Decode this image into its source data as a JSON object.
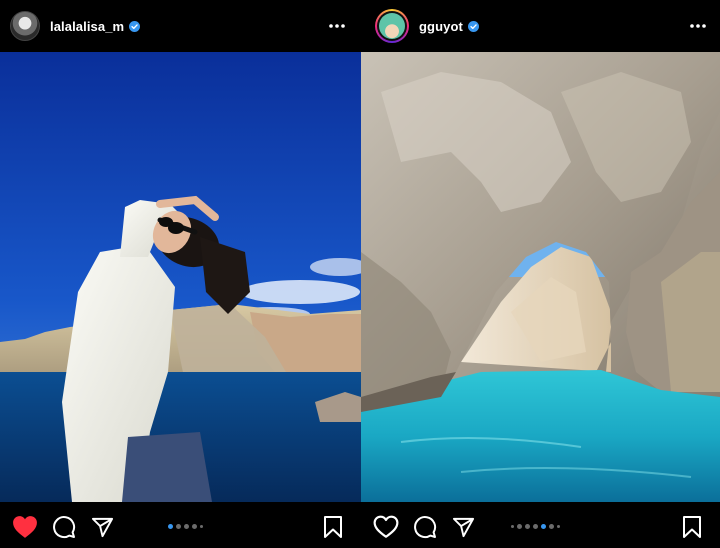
{
  "posts": [
    {
      "username": "lalalalisa_m",
      "verified": true,
      "liked": true,
      "active_slide": 0,
      "photo": "woman in white shirt and sunglasses on a boat, cliffs and blue sea behind"
    },
    {
      "username": "gguyot",
      "verified": true,
      "liked": false,
      "active_slide": 4,
      "photo": "natural rock arch over turquoise sea water"
    }
  ],
  "icons": {
    "more": "more-horizontal-icon",
    "like": "heart-icon",
    "comment": "comment-icon",
    "share": "paper-plane-icon",
    "save": "bookmark-icon",
    "verified": "verified-badge-icon"
  },
  "colors": {
    "background": "#000000",
    "like_active": "#ff3040",
    "verified": "#3897f0",
    "dot_active": "#3897f0",
    "dot_inactive": "#6b6b6b"
  }
}
